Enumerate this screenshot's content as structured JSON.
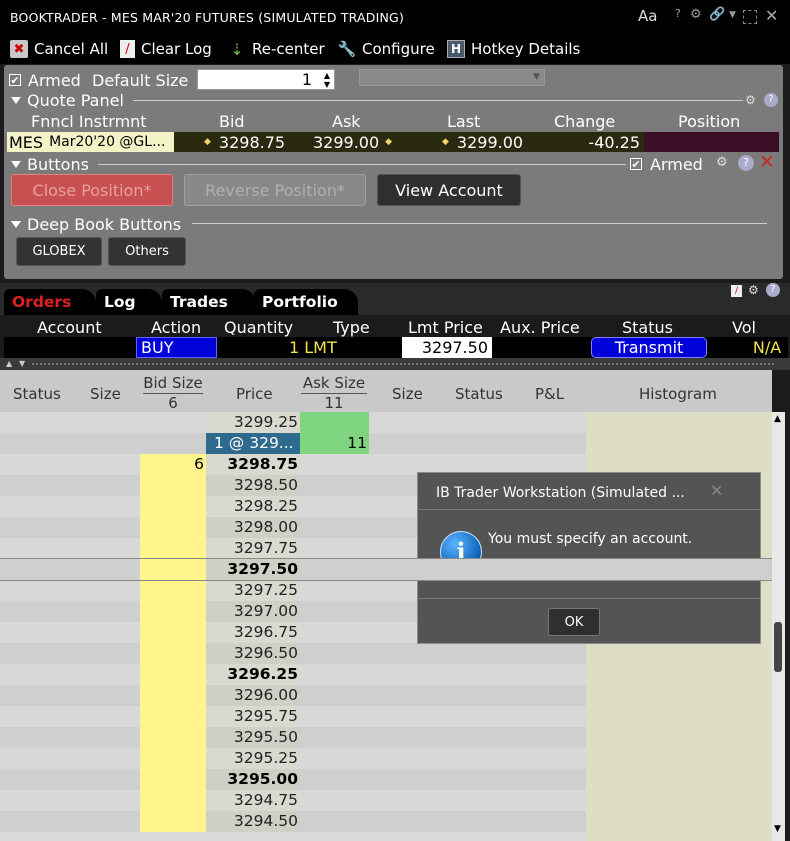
{
  "title_bar": {
    "title": "BOOKTRADER - MES MAR'20 FUTURES (SIMULATED TRADING)",
    "font_icon": "Aa",
    "help": "?"
  },
  "toolbar": {
    "cancel_all": "Cancel All",
    "clear_log": "Clear Log",
    "re_center": "Re-center",
    "configure": "Configure",
    "hotkey_details": "Hotkey Details",
    "hotkey_icon_letter": "H"
  },
  "order_entry": {
    "armed_label": "Armed",
    "default_size_label": "Default Size",
    "default_size_value": "1"
  },
  "quote_panel": {
    "title": "Quote Panel",
    "headers": [
      "Fnncl Instrmnt",
      "Bid",
      "Ask",
      "Last",
      "Change",
      "Position"
    ],
    "instrument_symbol": "MES",
    "instrument_desc": "Mar20'20 @GL...",
    "bid": "3298.75",
    "ask": "3299.00",
    "last": "3299.00",
    "change": "-40.25",
    "position": ""
  },
  "buttons_panel": {
    "title": "Buttons",
    "armed_label": "Armed",
    "close_position": "Close Position*",
    "reverse_position": "Reverse Position*",
    "view_account": "View Account"
  },
  "deep_book": {
    "title": "Deep Book Buttons",
    "globex": "GLOBEX",
    "others": "Others"
  },
  "tabs": [
    "Orders",
    "Log",
    "Trades",
    "Portfolio"
  ],
  "orders": {
    "headers": [
      "Account",
      "Action",
      "Quantity",
      "Type",
      "Lmt Price",
      "Aux. Price",
      "Status",
      "Vol"
    ],
    "row": {
      "account": "",
      "action": "BUY",
      "quantity": "1 LMT",
      "lmt_price": "3297.50",
      "aux_price": "",
      "status": "Transmit",
      "vol": "N/A"
    }
  },
  "book": {
    "headers": {
      "status_left": "Status",
      "size_left": "Size",
      "bid_size": "Bid Size",
      "bid_size_total": "6",
      "price": "Price",
      "ask_size": "Ask Size",
      "ask_size_total": "11",
      "size_right": "Size",
      "status_right": "Status",
      "pnl": "P&L",
      "histogram": "Histogram"
    },
    "rows": [
      {
        "price": "3299.25",
        "bid": "",
        "ask": "",
        "bold": false,
        "ask_zone": true,
        "bid_zone": false
      },
      {
        "price": "1 @ 329...",
        "bid": "",
        "ask": "11",
        "bold": false,
        "ask_zone": true,
        "bid_zone": false,
        "order": true
      },
      {
        "price": "3298.75",
        "bid": "6",
        "ask": "",
        "bold": true,
        "ask_zone": false,
        "bid_zone": true
      },
      {
        "price": "3298.50",
        "bid": "",
        "ask": "",
        "bold": false,
        "bid_zone": true
      },
      {
        "price": "3298.25",
        "bid": "",
        "ask": "",
        "bold": false,
        "bid_zone": true
      },
      {
        "price": "3298.00",
        "bid": "",
        "ask": "",
        "bold": false,
        "bid_zone": true
      },
      {
        "price": "3297.75",
        "bid": "",
        "ask": "",
        "bold": false,
        "bid_zone": true
      },
      {
        "price": "3297.50",
        "bid": "",
        "ask": "",
        "bold": true,
        "bid_zone": true,
        "selected": true
      },
      {
        "price": "3297.25",
        "bid": "",
        "ask": "",
        "bold": false,
        "bid_zone": true
      },
      {
        "price": "3297.00",
        "bid": "",
        "ask": "",
        "bold": false,
        "bid_zone": true
      },
      {
        "price": "3296.75",
        "bid": "",
        "ask": "",
        "bold": false,
        "bid_zone": true
      },
      {
        "price": "3296.50",
        "bid": "",
        "ask": "",
        "bold": false,
        "bid_zone": true
      },
      {
        "price": "3296.25",
        "bid": "",
        "ask": "",
        "bold": true,
        "bid_zone": true
      },
      {
        "price": "3296.00",
        "bid": "",
        "ask": "",
        "bold": false,
        "bid_zone": true
      },
      {
        "price": "3295.75",
        "bid": "",
        "ask": "",
        "bold": false,
        "bid_zone": true
      },
      {
        "price": "3295.50",
        "bid": "",
        "ask": "",
        "bold": false,
        "bid_zone": true
      },
      {
        "price": "3295.25",
        "bid": "",
        "ask": "",
        "bold": false,
        "bid_zone": true
      },
      {
        "price": "3295.00",
        "bid": "",
        "ask": "",
        "bold": true,
        "bid_zone": true
      },
      {
        "price": "3294.75",
        "bid": "",
        "ask": "",
        "bold": false,
        "bid_zone": true
      },
      {
        "price": "3294.50",
        "bid": "",
        "ask": "",
        "bold": false,
        "bid_zone": true
      }
    ]
  },
  "dialog": {
    "title": "IB Trader Workstation (Simulated ...",
    "message": "You must specify an account.",
    "ok": "OK",
    "info_glyph": "i"
  },
  "colors": {
    "bid_zone": "#fff58c",
    "ask_zone": "#7fd47f",
    "order_row": "#2d6a8e",
    "buy": "#0000d8",
    "transmit": "#0000d8",
    "change_negative": "#ffffff",
    "tab_active_text": "#e02020",
    "close_position_bg": "#c85050"
  }
}
